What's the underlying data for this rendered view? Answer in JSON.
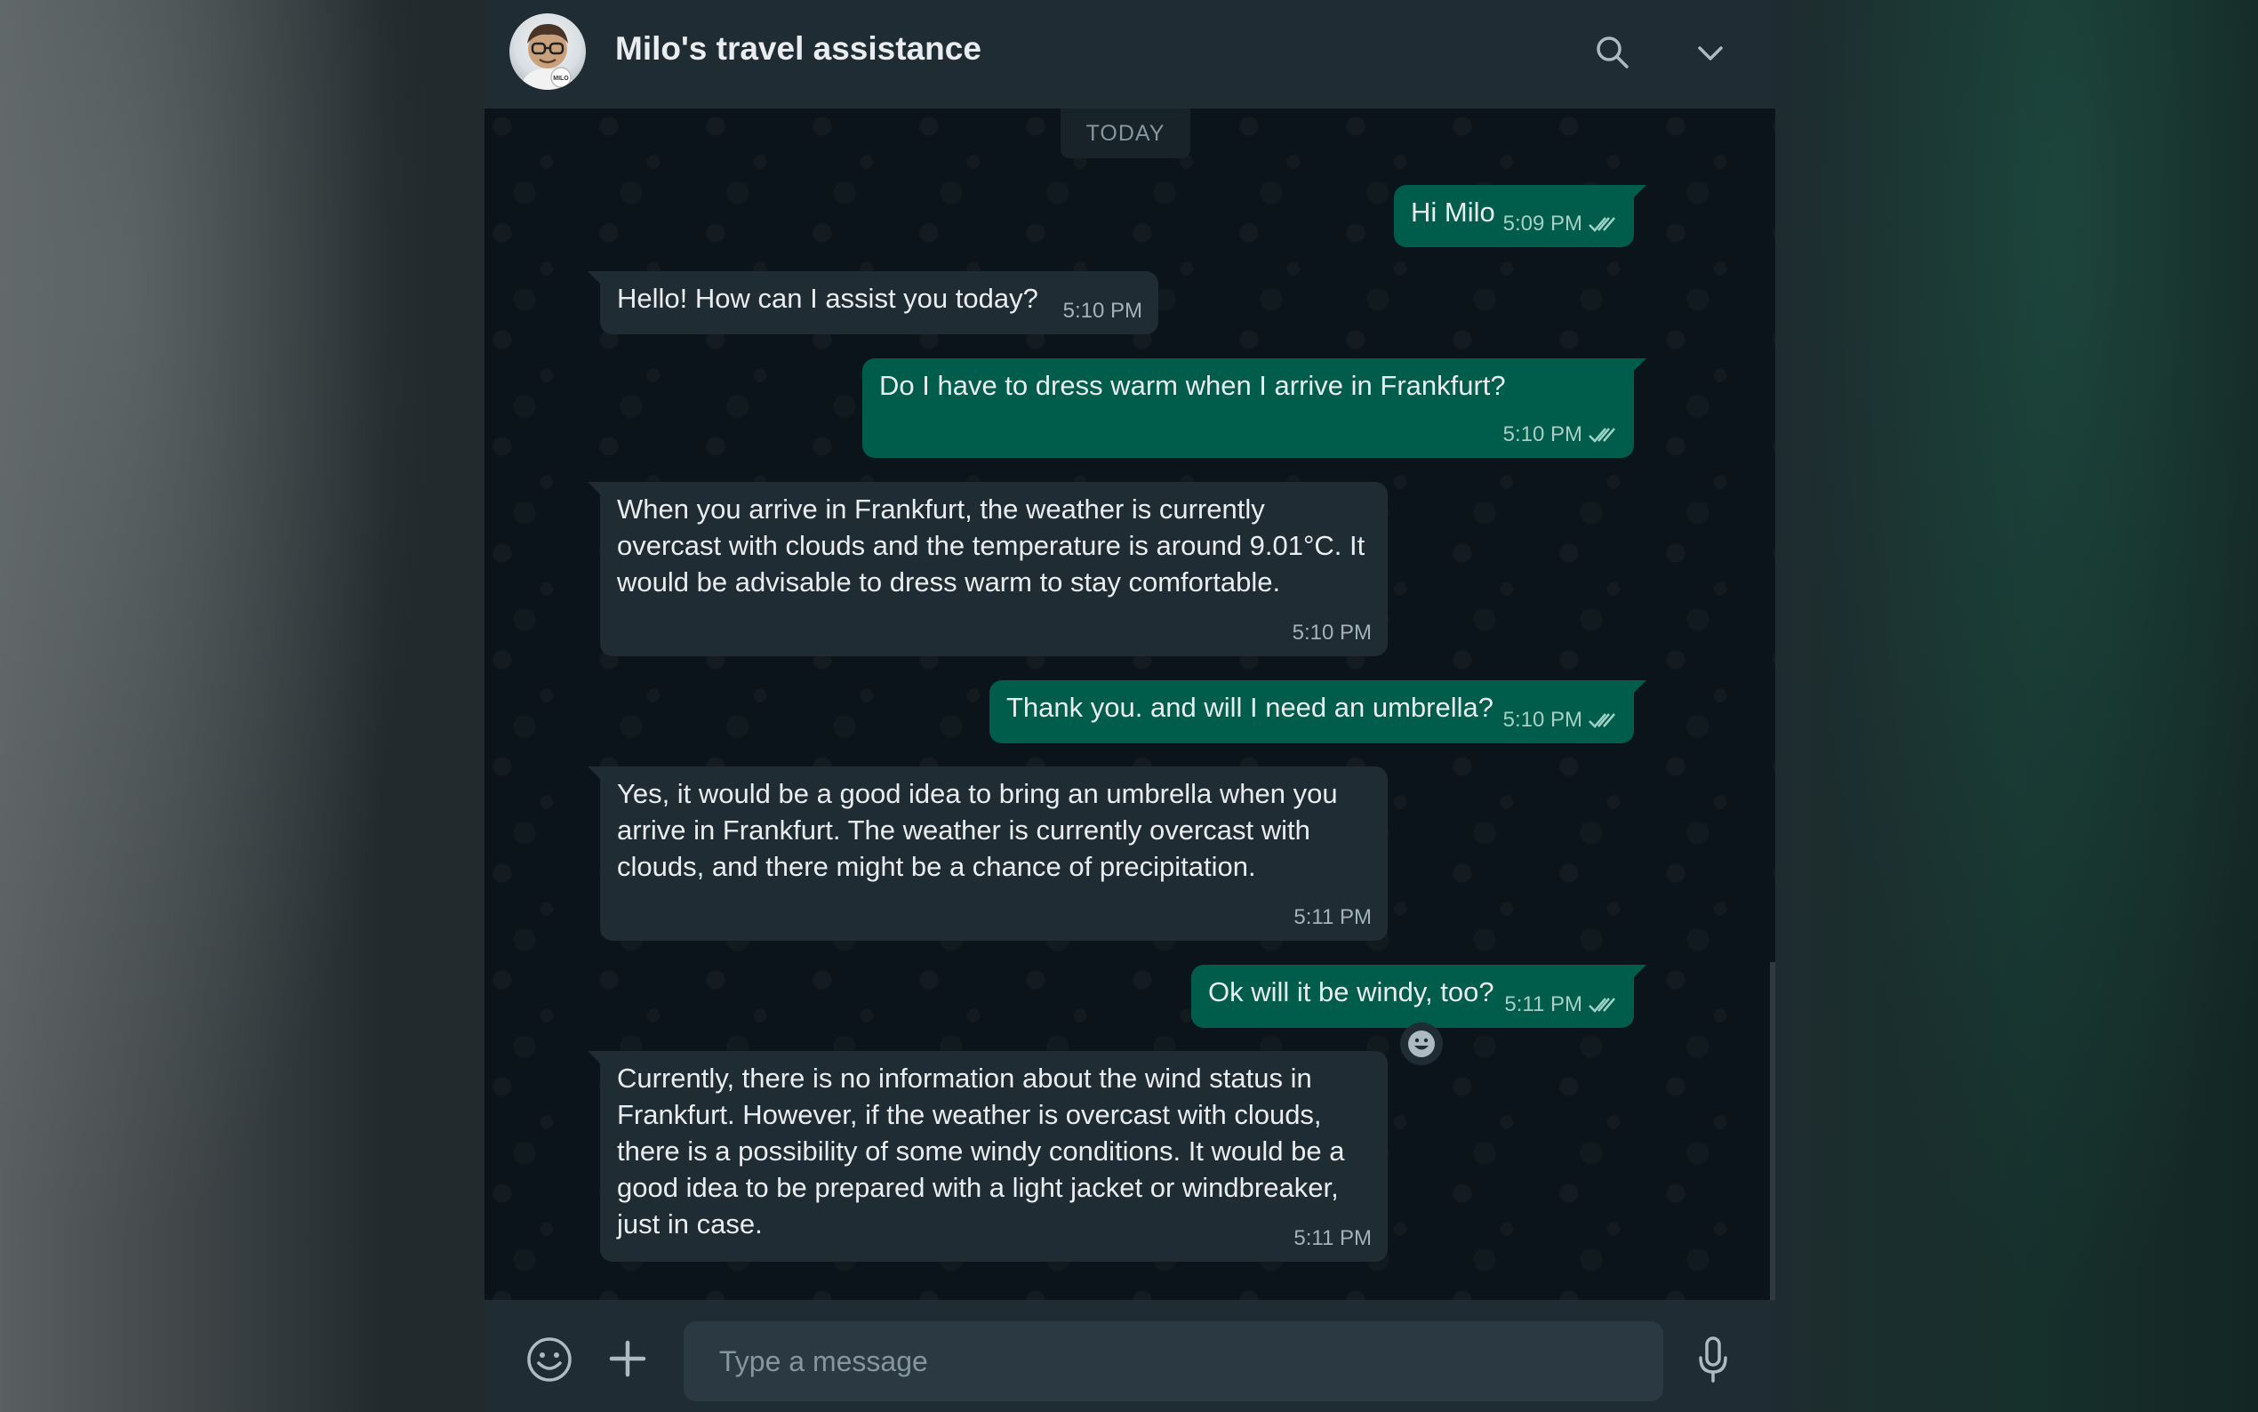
{
  "header": {
    "title": "Milo's travel assistance",
    "avatar_text": "MILO"
  },
  "chat": {
    "date_label": "TODAY",
    "messages": [
      {
        "direction": "out",
        "text": "Hi Milo",
        "time": "5:09 PM",
        "status": "read"
      },
      {
        "direction": "in",
        "text": "Hello! How can I assist you today?",
        "time": "5:10 PM"
      },
      {
        "direction": "out",
        "text": "Do I have to dress warm when I arrive in Frankfurt?",
        "time": "5:10 PM",
        "status": "read"
      },
      {
        "direction": "in",
        "text": "When you arrive in Frankfurt, the weather is currently overcast with clouds and the temperature is around 9.01°C. It would be advisable to dress warm to stay comfortable.",
        "time": "5:10 PM"
      },
      {
        "direction": "out",
        "text": "Thank you. and will I need an umbrella?",
        "time": "5:10 PM",
        "status": "read"
      },
      {
        "direction": "in",
        "text": "Yes, it would be a good idea to bring an umbrella when you arrive in Frankfurt. The weather is currently overcast with clouds, and there might be a chance of precipitation.",
        "time": "5:11 PM"
      },
      {
        "direction": "out",
        "text": "Ok will it be windy, too?",
        "time": "5:11 PM",
        "status": "read"
      },
      {
        "direction": "in",
        "text": "Currently, there is no information about the wind status in Frankfurt. However, if the weather is overcast with clouds, there is a possibility of some windy conditions. It would be a good idea to be prepared with a light jacket or windbreaker, just in case.",
        "time": "5:11 PM"
      }
    ]
  },
  "composer": {
    "placeholder": "Type a message"
  },
  "icons": {
    "search": "search-icon",
    "menu": "chevron-down-icon",
    "emoji": "emoji-icon",
    "attach": "plus-icon",
    "mic": "microphone-icon",
    "read_receipt": "double-check-icon",
    "react": "emoji-react-icon"
  },
  "colors": {
    "outgoing_bubble": "#005c4b",
    "incoming_bubble": "#202c33",
    "header": "#202c33",
    "chat_background": "#0b141a",
    "text": "#e9edef",
    "meta_text": "#8696a0"
  }
}
